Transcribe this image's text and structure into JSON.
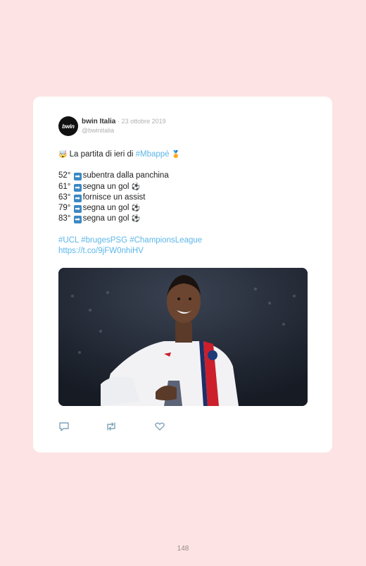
{
  "tweet": {
    "avatar_text": "bwin",
    "author": "bwin Italia",
    "date": "· 23 ottobre 2019",
    "handle": "@bwinitalia",
    "intro_emoji": "🤯",
    "intro_text": "La partita di ieri di ",
    "intro_link": "#Mbappé",
    "intro_end_emoji": "🏅",
    "events": [
      {
        "minute": "52°",
        "text": "subentra dalla panchina",
        "emoji": ""
      },
      {
        "minute": "61°",
        "text": "segna un gol",
        "emoji": "⚽"
      },
      {
        "minute": "63°",
        "text": "fornisce un assist",
        "emoji": ""
      },
      {
        "minute": "79°",
        "text": "segna un gol",
        "emoji": "⚽"
      },
      {
        "minute": "83°",
        "text": "segna un gol",
        "emoji": "⚽"
      }
    ],
    "hashtags": "#UCL #brugesPSG #ChampionsLeague",
    "url": "https://t.co/9jFW0nhiHV",
    "arrow_glyph": "➡",
    "actions": [
      "reply-icon",
      "retweet-icon",
      "like-icon"
    ]
  },
  "page_number": "148",
  "colors": {
    "background": "#fde3e3",
    "link": "#5cb6e8",
    "card": "#ffffff"
  }
}
